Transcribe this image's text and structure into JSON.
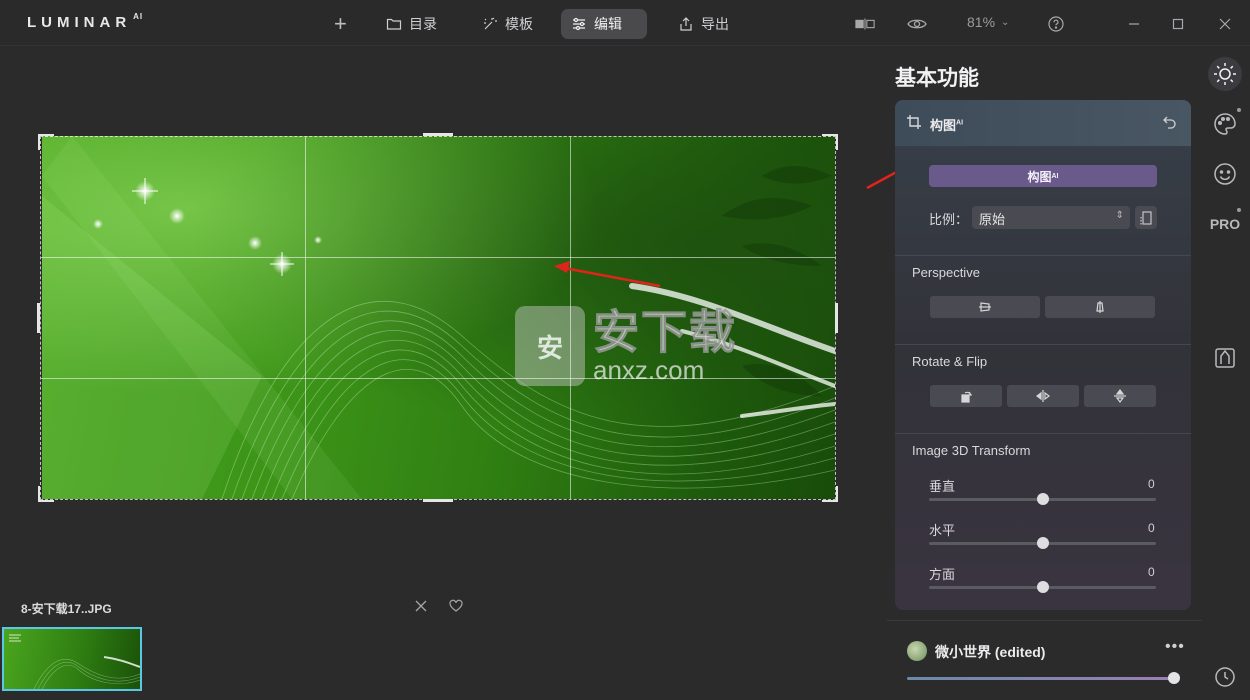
{
  "app": {
    "logo": "LUMINAR",
    "logo_sup": "AI"
  },
  "topbar": {
    "catalog_label": "目录",
    "templates_label": "模板",
    "edit_label": "编辑",
    "export_label": "导出",
    "zoom": "81%"
  },
  "canvas": {
    "watermark_big": "安下载",
    "watermark_small": "anxz.com",
    "watermark_shield": "安"
  },
  "filmstrip": {
    "file_name": "8-安下载17..JPG"
  },
  "panel": {
    "title": "基本功能",
    "compose": {
      "title": "构图",
      "title_sup": "AI",
      "ai_button": "构图",
      "ai_button_sup": "AI",
      "ratio_label": "比例：",
      "ratio_value": "原始"
    },
    "perspective": {
      "label": "Perspective"
    },
    "rotate_flip": {
      "label": "Rotate & Flip"
    },
    "transform3d": {
      "label": "Image 3D Transform",
      "sliders": [
        {
          "label": "垂直",
          "value": "0",
          "level": 0.5
        },
        {
          "label": "水平",
          "value": "0",
          "level": 0.5
        },
        {
          "label": "方面",
          "value": "0",
          "level": 0.5
        }
      ]
    }
  },
  "preset": {
    "name": "微小世界 (edited)",
    "more": "•••",
    "amount": 1.0
  },
  "rail": {
    "pro_label": "PRO"
  }
}
